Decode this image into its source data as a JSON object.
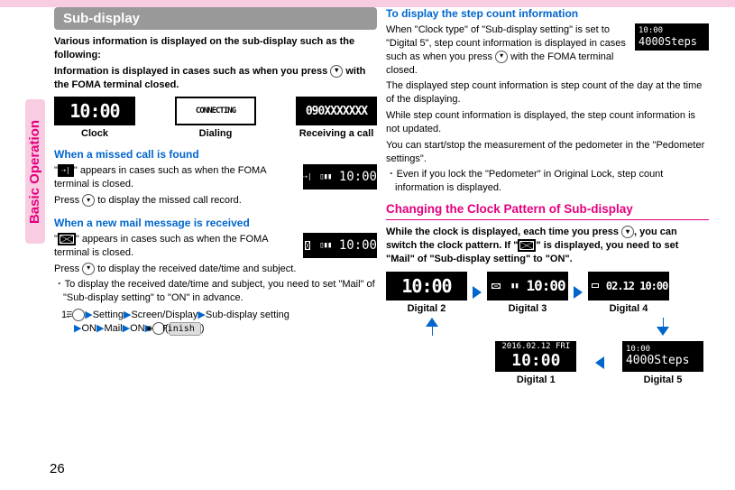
{
  "side_tab": "Basic Operation",
  "page_number": "26",
  "left": {
    "title": "Sub-display",
    "intro1": "Various information is displayed on the sub-display such as the following:",
    "intro2_a": "Information is displayed in cases such as when you press ",
    "intro2_b": " with the FOMA terminal closed.",
    "clock_sample": "10:00",
    "dialing_sample": "CONNECTING",
    "receiving_sample": "090XXXXXXX",
    "lbl_clock": "Clock",
    "lbl_dialing": "Dialing",
    "lbl_receiving": "Receiving a call",
    "missed_heading": "When a missed call is found",
    "missed_p1_a": "\"",
    "missed_p1_b": "\" appears in cases such as when the FOMA terminal is closed.",
    "missed_p2_a": "Press ",
    "missed_p2_b": " to display the missed call record.",
    "missed_lcd": "10:00",
    "mail_heading": "When a new mail message is received",
    "mail_p1_a": "\"",
    "mail_p1_b": "\" appears in cases such as when the FOMA terminal is closed.",
    "mail_p2_a": "Press ",
    "mail_p2_b": " to display the received date/time and subject.",
    "mail_lcd": "10:00",
    "mail_bullet": "To display the received date/time and subject, you need to set \"Mail\" of \"Sub-display setting\" to \"ON\" in advance.",
    "step_num": "1.",
    "step_parts": {
      "menu": "Setting",
      "a": "Screen/Display",
      "b": "Sub-display setting",
      "c": "ON",
      "d": "Mail",
      "e": "ON",
      "finish": "Finish"
    }
  },
  "right": {
    "heading1": "To display the step count information",
    "p1": "When \"Clock type\" of \"Sub-display setting\" is set to \"Digital 5\", step count information is displayed in cases such as when you press ",
    "p1b": " with the FOMA terminal closed.",
    "side_lcd_time": "10:00",
    "side_lcd_steps": "4000Steps",
    "p2": "The displayed step count information is step count of the day at the time of the displaying.",
    "p3": "While step count information is displayed, the step count information is not updated.",
    "p4": "You can start/stop the measurement of the pedometer in the \"Pedometer settings\".",
    "bullet": "Even if you lock the \"Pedometer\" in Original Lock, step count information is displayed.",
    "heading2": "Changing the Clock Pattern of Sub-display",
    "h2_p1a": "While the clock is displayed, each time you press ",
    "h2_p1b": ", you can switch the clock pattern. If \"",
    "h2_p1c": "\" is displayed, you need to set \"Mail\" of \"Sub-display setting\" to \"ON\".",
    "d2_lcd": "10:00",
    "d3_lcd": "10:00",
    "d4_lcd_date": "02.12",
    "d4_lcd_time": "10:00",
    "lbl_d2": "Digital 2",
    "lbl_d3": "Digital 3",
    "lbl_d4": "Digital 4",
    "d1_top": "2016.02.12 FRI",
    "d1_time": "10:00",
    "d5_time": "10:00",
    "d5_steps": "4000Steps",
    "lbl_d1": "Digital 1",
    "lbl_d5": "Digital 5"
  },
  "chart_data": {
    "type": "diagram",
    "title": "Clock pattern cycle of Sub-display",
    "nodes": [
      "Digital 2",
      "Digital 3",
      "Digital 4",
      "Digital 5",
      "Digital 1"
    ],
    "edges": [
      [
        "Digital 2",
        "Digital 3"
      ],
      [
        "Digital 3",
        "Digital 4"
      ],
      [
        "Digital 4",
        "Digital 5"
      ],
      [
        "Digital 5",
        "Digital 1"
      ],
      [
        "Digital 1",
        "Digital 2"
      ]
    ]
  }
}
